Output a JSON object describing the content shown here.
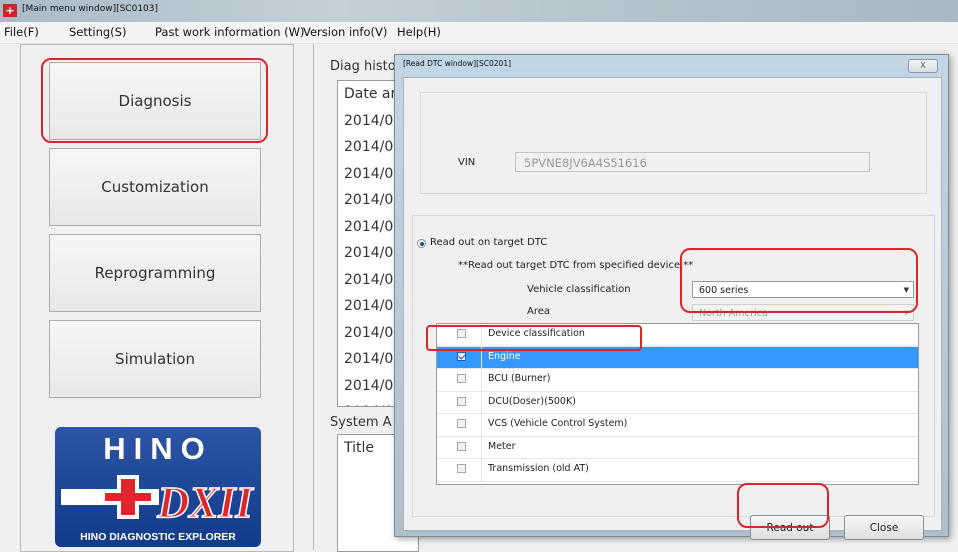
{
  "window": {
    "title": "[Main menu window][SC0103]",
    "app_icon": "hino-app-icon"
  },
  "menu": [
    "File(F)",
    "Setting(S)",
    "Past work information (W)",
    "Version info(V)",
    "Help(H)"
  ],
  "nav": [
    {
      "label": "Diagnosis",
      "icon": ""
    },
    {
      "label": "Customization",
      "icon": ""
    },
    {
      "label": "Reprogramming",
      "icon": ""
    },
    {
      "label": "Simulation",
      "icon": ""
    }
  ],
  "logo": {
    "brand": "HINO",
    "mark": "DXII",
    "tagline": "HINO DIAGNOSTIC EXPLORER"
  },
  "background": {
    "diag_history_label": "Diag histo",
    "date_header": "Date ar",
    "date_rows": [
      "2014/0",
      "2014/0",
      "2014/0",
      "2014/0",
      "2014/0",
      "2014/0",
      "2014/0",
      "2014/0",
      "2014/0",
      "2014/0",
      "2014/0",
      "2014/0"
    ],
    "system_label": "System A",
    "title_header": "Title"
  },
  "dialog": {
    "title": "[Read DTC window][SC0201]",
    "close_glyph": "X",
    "vin_label": "VIN",
    "vin_value": "5PVNE8JV6A4S51616",
    "radio_label": "Read out on target DTC",
    "instruction": "**Read out target DTC from specified device.**",
    "vehicle_label": "Vehicle classification",
    "vehicle_value": "600 series",
    "area_label": "Area",
    "area_value": "North America",
    "device_header": "Device classification",
    "devices": [
      {
        "label": "Engine",
        "checked": true,
        "selected": true
      },
      {
        "label": "BCU (Burner)",
        "checked": false,
        "selected": false
      },
      {
        "label": "DCU(Doser)(500K)",
        "checked": false,
        "selected": false
      },
      {
        "label": "VCS (Vehicle Control System)",
        "checked": false,
        "selected": false
      },
      {
        "label": "Meter",
        "checked": false,
        "selected": false
      },
      {
        "label": "Transmission (old AT)",
        "checked": false,
        "selected": false
      }
    ],
    "read_out_label": "Read out",
    "close_label": "Close"
  },
  "colors": {
    "highlight": "#d9262c",
    "selection": "#3399ff",
    "logo_blue": "#1e4898",
    "logo_red": "#e0262c"
  }
}
